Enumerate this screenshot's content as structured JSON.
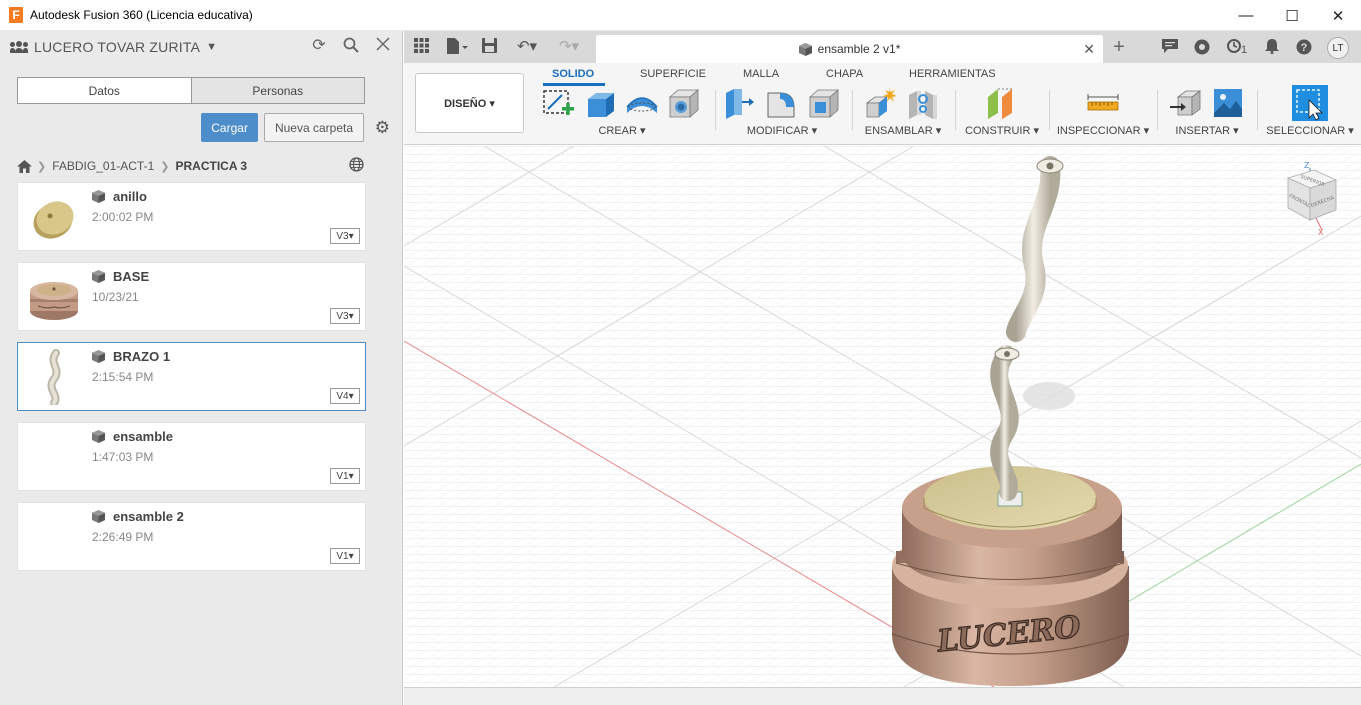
{
  "window": {
    "title": "Autodesk Fusion 360 (Licencia educativa)",
    "app_icon_letter": "F",
    "minimize": "—",
    "maximize": "☐",
    "close": "✕"
  },
  "data_panel": {
    "user": "LUCERO TOVAR ZURITA",
    "tabs": [
      "Datos",
      "Personas"
    ],
    "upload_label": "Cargar",
    "new_folder_label": "Nueva carpeta",
    "breadcrumb": [
      "FABDIG_01-ACT-1",
      "PRACTICA 3"
    ],
    "files": [
      {
        "name": "anillo",
        "date": "2:00:02 PM",
        "version": "V3"
      },
      {
        "name": "BASE",
        "date": "10/23/21",
        "version": "V3"
      },
      {
        "name": "BRAZO 1",
        "date": "2:15:54 PM",
        "version": "V4"
      },
      {
        "name": "ensamble",
        "date": "1:47:03 PM",
        "version": "V1"
      },
      {
        "name": "ensamble 2",
        "date": "2:26:49 PM",
        "version": "V1"
      }
    ]
  },
  "app_bar": {
    "document_tab": "ensamble 2 v1*",
    "job_count": "1",
    "user_initials": "LT"
  },
  "toolbar": {
    "workspace": "DISEÑO ▾",
    "tabs": [
      "SOLIDO",
      "SUPERFICIE",
      "MALLA",
      "CHAPA",
      "HERRAMIENTAS"
    ],
    "groups": [
      "CREAR ▾",
      "MODIFICAR ▾",
      "ENSAMBLAR ▾",
      "CONSTRUIR ▾",
      "INSPECCIONAR ▾",
      "INSERTAR ▾",
      "SELECCIONAR ▾"
    ]
  },
  "viewcube": {
    "top_face": "SUPERIOR",
    "front_face": "FRONTAL",
    "right_face": "DERECHA",
    "axis_z": "Z",
    "axis_x": "X"
  },
  "model": {
    "engraving": "LUCERO"
  },
  "colors": {
    "accent": "#1a6fbf",
    "upload_button": "#4d8dc9",
    "copper": "#c39a84",
    "brass": "#d8cc9a",
    "silver": "#ddd8cc"
  }
}
